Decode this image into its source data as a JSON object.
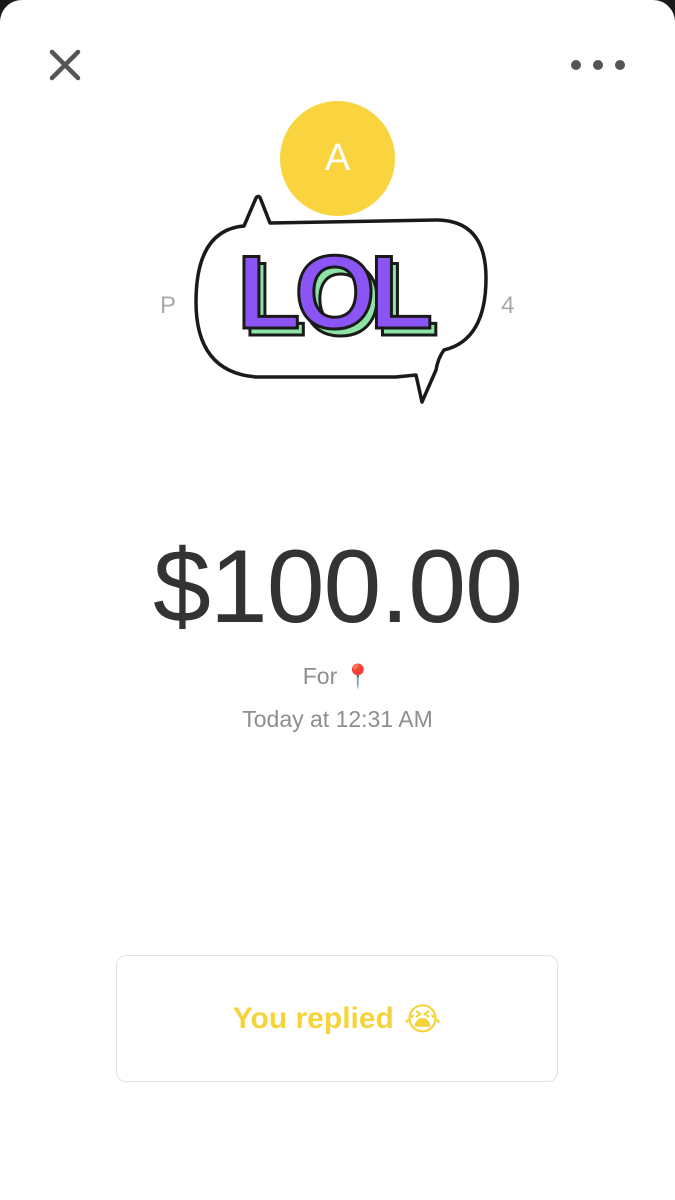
{
  "header": {
    "close_icon": "close-icon",
    "more_icon": "more-horizontal-icon"
  },
  "recipient": {
    "avatar_initial": "A",
    "avatar_color": "#F9D43F",
    "name_start": "P",
    "name_end": "4"
  },
  "sticker": {
    "text": "LOL",
    "letter_color": "#8A55F4",
    "shadow_color": "#8CE3A4"
  },
  "payment": {
    "amount": "$100.00",
    "for_label": "For",
    "for_emoji": "📍",
    "timestamp": "Today at 12:31 AM"
  },
  "reply": {
    "label": "You replied",
    "emoji": "😭",
    "color": "#F5D33A"
  }
}
